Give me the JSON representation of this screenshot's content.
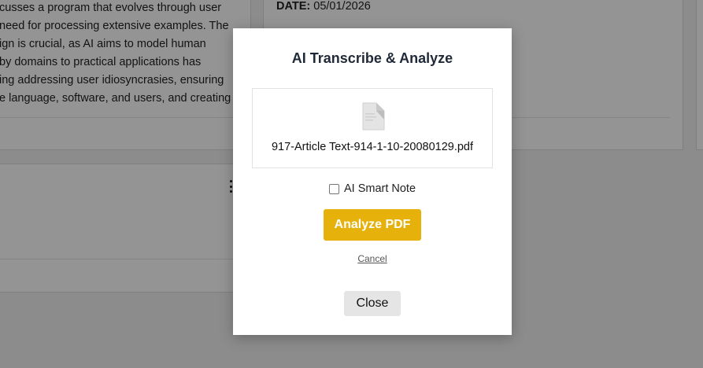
{
  "background": {
    "article_lines": [
      "cusses a program that evolves through user",
      "need for processing extensive examples. The",
      "ign is crucial, as AI aims to model human",
      "by domains to practical applications has",
      "ing addressing user idiosyncrasies, ensuring",
      "e language, software, and users, and creating"
    ],
    "date_label": "DATE:",
    "date_value": "05/01/2026"
  },
  "modal": {
    "title": "AI Transcribe & Analyze",
    "file_name": "917-Article Text-914-1-10-20080129.pdf",
    "smart_note_label": "AI Smart Note",
    "smart_note_checked": false,
    "analyze_label": "Analyze PDF",
    "cancel_label": "Cancel",
    "close_label": "Close"
  },
  "colors": {
    "analyze_button": "#e6b10b",
    "overlay": "rgba(0,0,0,0.42)"
  }
}
